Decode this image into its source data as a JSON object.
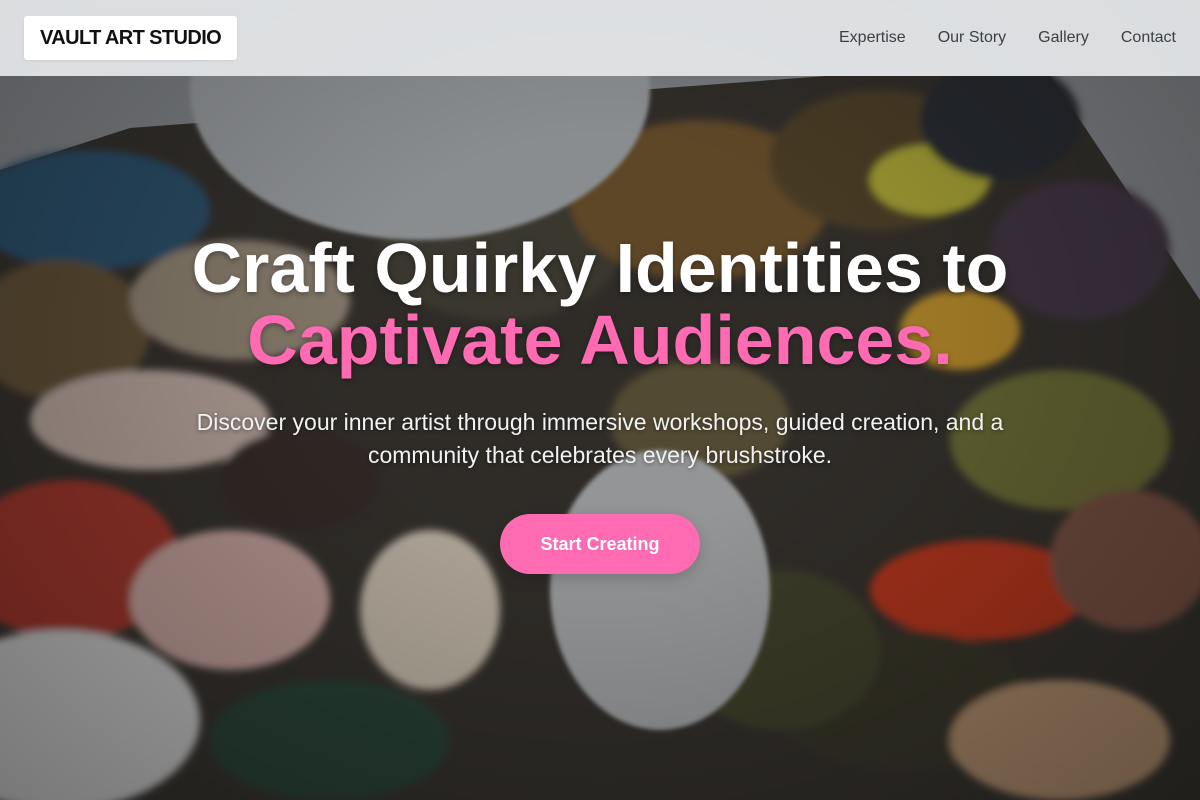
{
  "header": {
    "logo_text": "VAULT ART STUDIO",
    "nav": [
      {
        "label": "Expertise"
      },
      {
        "label": "Our Story"
      },
      {
        "label": "Gallery"
      },
      {
        "label": "Contact"
      }
    ]
  },
  "hero": {
    "headline_line1": "Craft Quirky Identities to",
    "headline_line2": "Captivate Audiences.",
    "subtitle": "Discover your inner artist through immersive workshops, guided creation, and a community that celebrates every brushstroke.",
    "cta_label": "Start Creating"
  },
  "colors": {
    "accent": "#ff6bb3",
    "header_bg": "#e8eaec",
    "nav_text": "#3b3f45",
    "headline": "#ffffff"
  },
  "background": {
    "image": "paint-palette-photo"
  }
}
